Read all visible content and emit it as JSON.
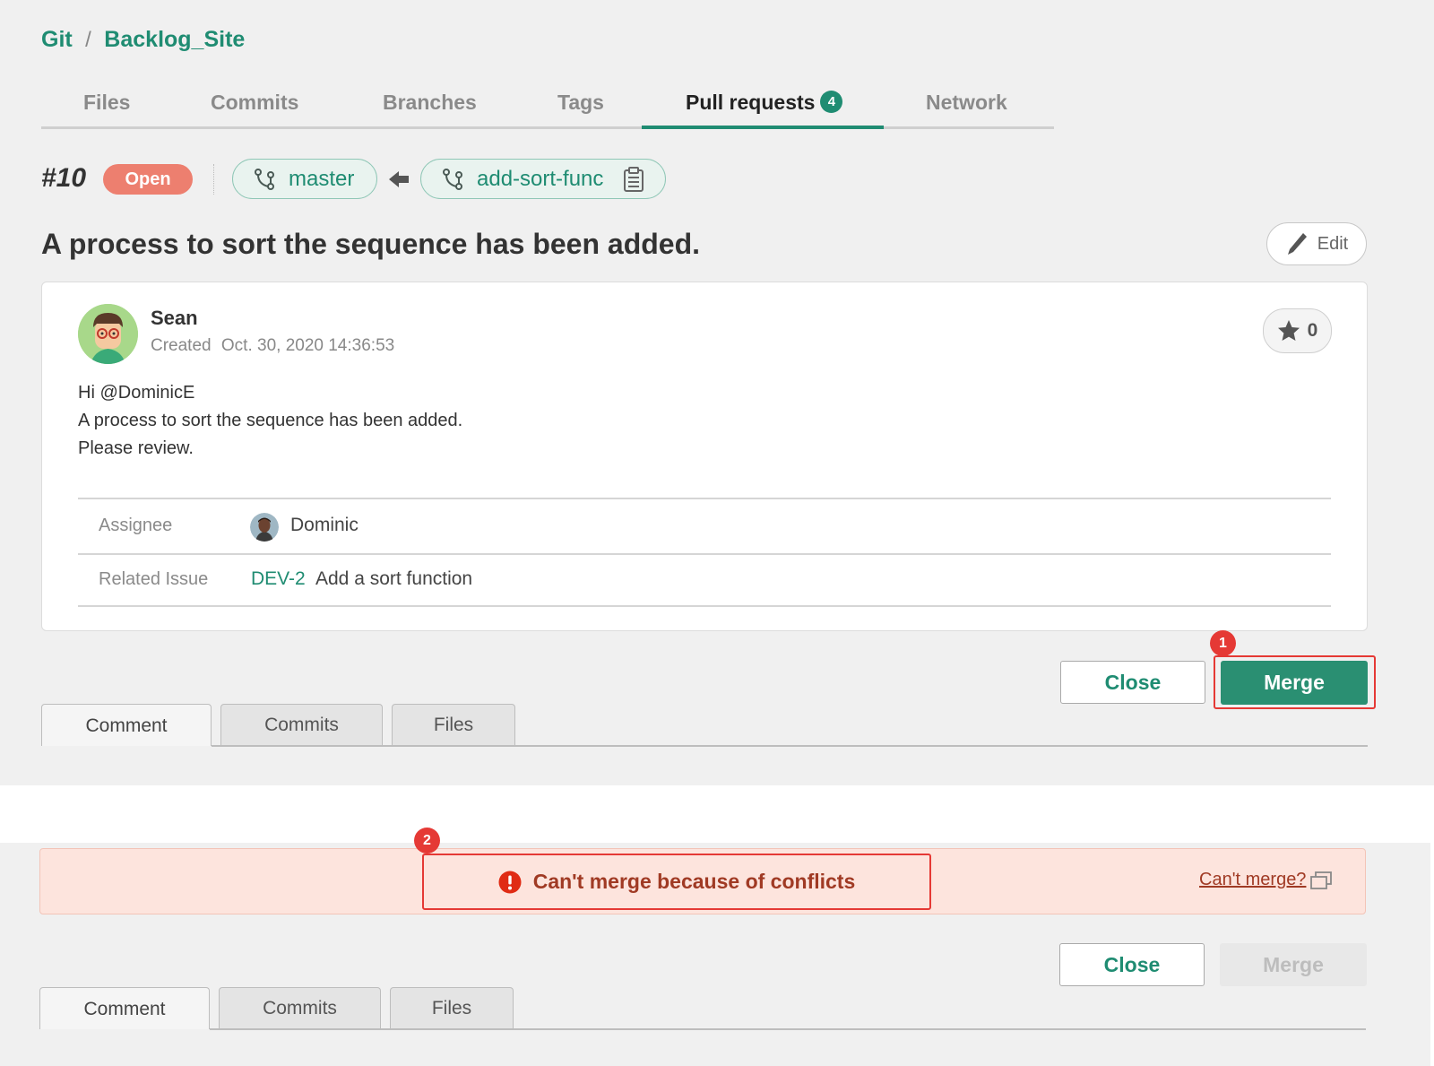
{
  "breadcrumb": {
    "root": "Git",
    "separator": "/",
    "project": "Backlog_Site"
  },
  "nav_tabs": [
    {
      "label": "Files"
    },
    {
      "label": "Commits"
    },
    {
      "label": "Branches"
    },
    {
      "label": "Tags"
    },
    {
      "label": "Pull requests",
      "badge": "4",
      "active": true
    },
    {
      "label": "Network"
    }
  ],
  "pull_request": {
    "number": "#10",
    "status": "Open",
    "base_branch": "master",
    "compare_branch": "add-sort-func",
    "title": "A process to sort the sequence has been added.",
    "edit_label": "Edit",
    "author": "Sean",
    "created_label": "Created",
    "created_at": "Oct. 30, 2020 14:36:53",
    "star_count": "0",
    "description": [
      "Hi @DominicE",
      "A process to sort the sequence has been added.",
      "Please review."
    ],
    "assignee_label": "Assignee",
    "assignee": "Dominic",
    "related_issue_label": "Related Issue",
    "issue_key": "DEV-2",
    "issue_title": "Add a sort function"
  },
  "actions_top": {
    "close_label": "Close",
    "merge_label": "Merge",
    "step": "1"
  },
  "sub_tabs_top": [
    "Comment",
    "Commits",
    "Files"
  ],
  "conflict_alert": {
    "step": "2",
    "message": "Can't merge because of conflicts",
    "help_link": "Can't merge?"
  },
  "actions_bottom": {
    "close_label": "Close",
    "merge_label": "Merge"
  },
  "sub_tabs_bottom": [
    "Comment",
    "Commits",
    "Files"
  ],
  "colors": {
    "accent": "#1f8c72",
    "merge_button": "#2a8f72",
    "status_open": "#ed7f6f",
    "highlight": "#e53935",
    "alert_bg": "#fde4dd"
  }
}
